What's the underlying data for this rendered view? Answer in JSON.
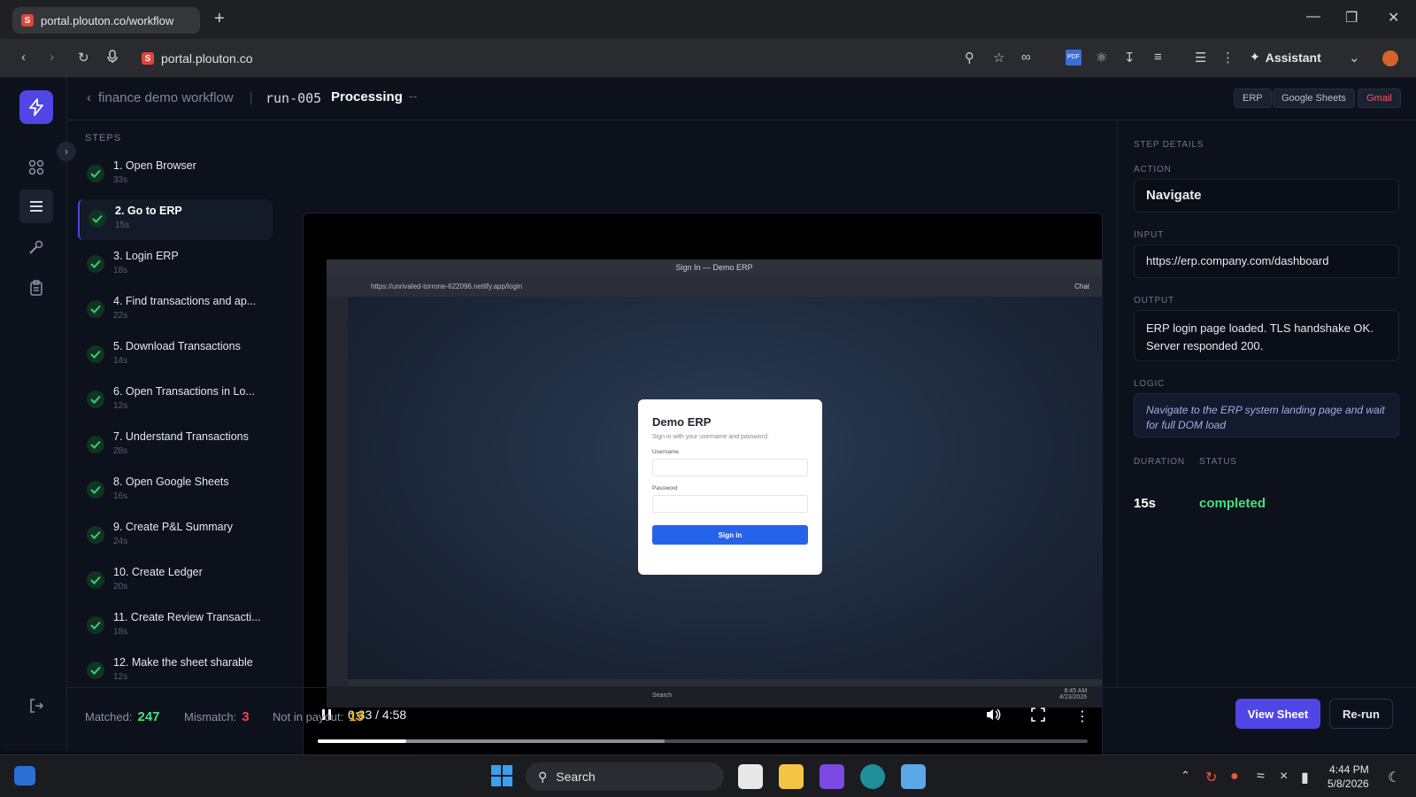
{
  "browser": {
    "tab_title": "portal.plouton.co/workflow",
    "url": "portal.plouton.co",
    "assistant_label": "Assistant",
    "pdf_badge": "PDF"
  },
  "header": {
    "back_label": "finance demo workflow",
    "run_id": "run-005",
    "status": "Processing",
    "dash": "--",
    "integrations": [
      "ERP",
      "Google Sheets",
      "Gmail"
    ]
  },
  "steps": {
    "title": "STEPS",
    "items": [
      {
        "label": "1. Open Browser",
        "duration": "33s"
      },
      {
        "label": "2. Go to ERP",
        "duration": "15s"
      },
      {
        "label": "3. Login ERP",
        "duration": "18s"
      },
      {
        "label": "4. Find transactions and ap...",
        "duration": "22s"
      },
      {
        "label": "5. Download Transactions",
        "duration": "14s"
      },
      {
        "label": "6. Open Transactions in Lo...",
        "duration": "12s"
      },
      {
        "label": "7. Understand Transactions",
        "duration": "28s"
      },
      {
        "label": "8. Open Google Sheets",
        "duration": "16s"
      },
      {
        "label": "9. Create P&L Summary",
        "duration": "24s"
      },
      {
        "label": "10. Create Ledger",
        "duration": "20s"
      },
      {
        "label": "11. Create Review Transacti...",
        "duration": "18s"
      },
      {
        "label": "12. Make the sheet sharable",
        "duration": "12s"
      }
    ],
    "active_index": 1
  },
  "video": {
    "time": "0:33 / 4:58",
    "progress": 0.115,
    "buffered": 0.45,
    "inner_window_title": "Sign In — Demo ERP",
    "inner_url": "https://unrivaled-torrone-622096.netlify.app/login",
    "inner_chat": "Chat",
    "inner_search": "Search",
    "inner_clock_time": "8:45 AM",
    "inner_clock_date": "4/23/2026",
    "login": {
      "title": "Demo ERP",
      "subtitle": "Sign in with your username and password.",
      "username_label": "Username",
      "password_label": "Password",
      "button": "Sign in"
    }
  },
  "details": {
    "title": "STEP DETAILS",
    "action_label": "ACTION",
    "action": "Navigate",
    "input_label": "INPUT",
    "input": "https://erp.company.com/dashboard",
    "output_label": "OUTPUT",
    "output": "ERP login page loaded. TLS handshake OK. Server responded 200.",
    "logic_label": "LOGIC",
    "logic": "Navigate to the ERP system landing page and wait for full DOM load",
    "duration_label": "DURATION",
    "duration": "15s",
    "status_label": "STATUS",
    "status": "completed"
  },
  "footer": {
    "matched_label": "Matched:",
    "matched": "247",
    "mismatch_label": "Mismatch:",
    "mismatch": "3",
    "notpayout_label": "Not in payout:",
    "notpayout": "15",
    "view_sheet": "View Sheet",
    "rerun": "Re-run"
  },
  "taskbar": {
    "search": "Search",
    "time": "4:44 PM",
    "date": "5/8/2026"
  },
  "colors": {
    "accent": "#4f46e5",
    "success": "#4ade80",
    "mismatch": "#ef4444",
    "warning": "#f5b800",
    "gmail": "#ef5a6f"
  }
}
